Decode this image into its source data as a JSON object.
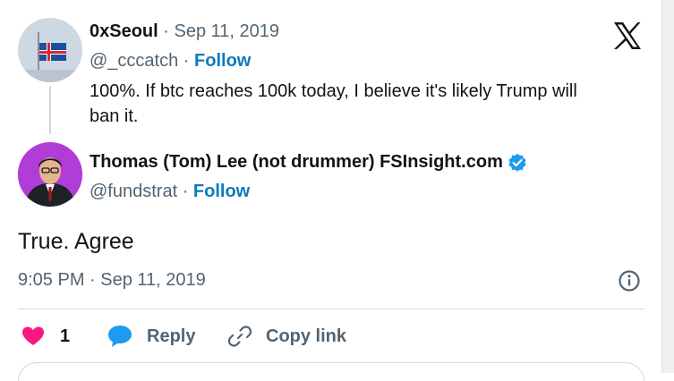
{
  "quoted": {
    "display_name": "0xSeoul",
    "separator": "·",
    "date": "Sep 11, 2019",
    "handle": "@_cccatch",
    "follow": "Follow",
    "text_line1": "100%. If btc reaches 100k today, I believe it's likely Trump will",
    "text_line2": "ban it."
  },
  "main": {
    "display_name": "Thomas (Tom) Lee (not drummer) FSInsight.com",
    "handle": "@fundstrat",
    "separator": "·",
    "follow": "Follow",
    "text": "True. Agree",
    "timestamp": "9:05 PM · Sep 11, 2019"
  },
  "actions": {
    "like_count": "1",
    "reply_label": "Reply",
    "copy_label": "Copy link"
  },
  "icons": {
    "brand": "x-logo-icon",
    "info": "info-icon",
    "like": "heart-icon",
    "reply": "speech-bubble-icon",
    "copy": "link-icon",
    "verified": "verified-badge-icon"
  },
  "colors": {
    "follow": "#0c7abf",
    "like": "#f91880",
    "reply": "#1d9bf0",
    "verified": "#1d9bf0",
    "text": "#0f1419",
    "muted": "#536471"
  }
}
